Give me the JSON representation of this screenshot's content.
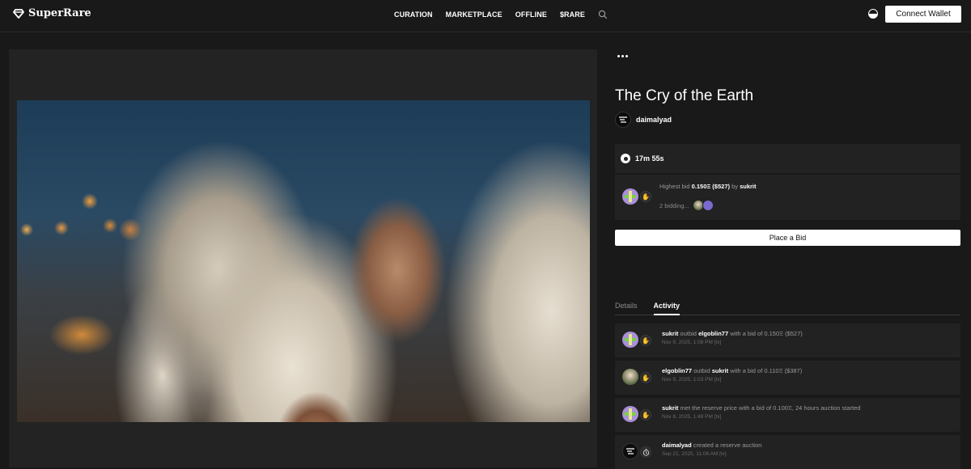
{
  "brand": {
    "name": "SuperRare"
  },
  "nav": {
    "items": [
      "CURATION",
      "MARKETPLACE",
      "OFFLINE",
      "$RARE"
    ],
    "connect_label": "Connect Wallet"
  },
  "artwork": {
    "title": "The Cry of the Earth",
    "artist": "daimalyad",
    "timer": "17m 55s",
    "highest_bid_prefix": "Highest bid",
    "highest_bid_amount": "0.150Ξ ($527)",
    "highest_bid_by": "by",
    "highest_bidder": "sukrit",
    "bidding_text": "2 bidding...",
    "place_bid_label": "Place a Bid"
  },
  "tabs": [
    "Details",
    "Activity"
  ],
  "activity": [
    {
      "user": "sukrit",
      "text1": "outbid",
      "user2": "elgoblin77",
      "text2": "with a bid of 0.150Ξ ($527)",
      "date": "Nov 9, 2025, 1:08 PM [tx]"
    },
    {
      "user": "elgoblin77",
      "text1": "outbid",
      "user2": "sukrit",
      "text2": "with a bid of 0.110Ξ ($387)",
      "date": "Nov 9, 2025, 1:03 PM [tx]"
    },
    {
      "user": "sukrit",
      "text1": "met the reserve price with a bid of 0.100Ξ, 24 hours auction started",
      "user2": "",
      "text2": "",
      "date": "Nov 8, 2025, 1:48 PM [tx]"
    },
    {
      "user": "daimalyad",
      "text1": "created a reserve auction",
      "user2": "",
      "text2": "",
      "date": "Sep 21, 2025, 11:06 AM [tx]"
    }
  ],
  "icons": {
    "logo": "diamond-icon",
    "search": "search-icon",
    "theme": "theme-toggle-icon",
    "more": "more-icon",
    "timer": "timer-dot-icon",
    "bid": "hand-icon",
    "created": "clock-icon"
  }
}
